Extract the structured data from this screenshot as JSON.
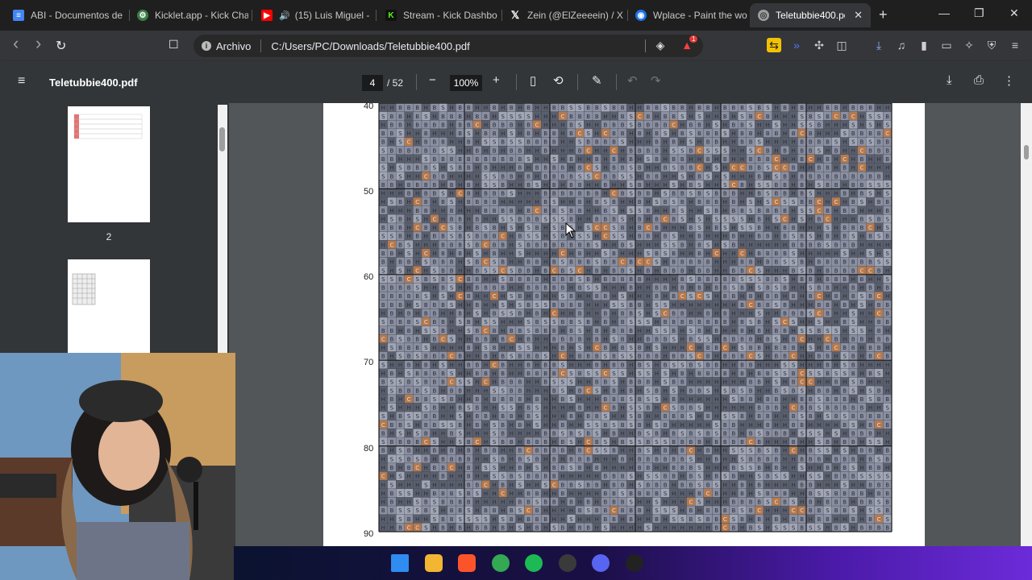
{
  "tabs": [
    {
      "title": "ABI - Documentos de",
      "favicon": "docs-icon",
      "color": "#4285f4"
    },
    {
      "title": "Kicklet.app - Kick Cha",
      "favicon": "kicklet-icon",
      "color": "#3a7d44"
    },
    {
      "title": "(15) Luis Miguel -",
      "favicon": "youtube-icon",
      "color": "#ff0000",
      "audio": "🔊"
    },
    {
      "title": "Stream - Kick Dashbo",
      "favicon": "kick-icon",
      "color": "#53fc18"
    },
    {
      "title": "Zein (@ElZeeeein) / X",
      "favicon": "x-icon",
      "color": "#000000"
    },
    {
      "title": "Wplace - Paint the wo",
      "favicon": "globe-icon",
      "color": "#1a73e8"
    },
    {
      "title": "Teletubbie400.pd",
      "favicon": "pdf-icon",
      "color": "#9e9e9e",
      "active": true
    }
  ],
  "tab_close": "✕",
  "new_tab": "+",
  "window_controls": {
    "minimize": "—",
    "maximize": "❐",
    "close": "✕"
  },
  "address": {
    "scheme_label": "Archivo",
    "url": "C:/Users/PC/Downloads/Teletubbie400.pdf",
    "info_icon": "i"
  },
  "nav": {
    "back": "‹",
    "forward": "›",
    "reload": "↻",
    "bookmark": "☐"
  },
  "extensions": [
    {
      "name": "brave-shield-icon",
      "glyph": "🛡"
    },
    {
      "name": "brave-rewards-icon",
      "glyph": "▲",
      "badge": "1"
    },
    {
      "name": "extension-yellow-icon",
      "glyph": "⇆"
    },
    {
      "name": "extension-blue-icon",
      "glyph": "»"
    },
    {
      "name": "extensions-puzzle-icon",
      "glyph": "⚙"
    },
    {
      "name": "screenshot-icon",
      "glyph": "◫"
    },
    {
      "name": "downloads-icon",
      "glyph": "⤓"
    },
    {
      "name": "media-icon",
      "glyph": "♫"
    },
    {
      "name": "sidebar-icon",
      "glyph": "▯"
    },
    {
      "name": "wallet-icon",
      "glyph": "▭"
    },
    {
      "name": "leo-icon",
      "glyph": "✧"
    },
    {
      "name": "vpn-icon",
      "glyph": "⛨"
    },
    {
      "name": "menu-icon",
      "glyph": "≡"
    }
  ],
  "pdf": {
    "menu_glyph": "≡",
    "title": "Teletubbie400.pdf",
    "page_current": "4",
    "page_total": "/ 52",
    "zoom": "100%",
    "zoom_out": "−",
    "zoom_in": "+",
    "fit_glyph": "▯",
    "rotate_glyph": "⟲",
    "annotate_glyph": "✎",
    "undo_glyph": "↶",
    "redo_glyph": "↷",
    "download_glyph": "⤓",
    "print_glyph": "⎙",
    "more_glyph": "⋮"
  },
  "thumbnails": [
    {
      "label": "2"
    },
    {
      "label": ""
    }
  ],
  "grid": {
    "row_labels": [
      "40",
      "50",
      "60",
      "70",
      "80",
      "90"
    ],
    "symbols": [
      "B",
      "H",
      "S",
      "C"
    ],
    "colors": {
      "B": "#8a8fa2",
      "H": "#5a5f6e",
      "S": "#a1a6b6",
      "C": "#b37a52"
    }
  },
  "taskbar_icons": [
    {
      "name": "windows-start-icon",
      "color": "#2f8cf0"
    },
    {
      "name": "file-explorer-icon",
      "color": "#f2b632"
    },
    {
      "name": "brave-browser-icon",
      "color": "#fb542b"
    },
    {
      "name": "chrome-icon",
      "color": "#34a853"
    },
    {
      "name": "spotify-icon",
      "color": "#1db954"
    },
    {
      "name": "obs-icon",
      "color": "#3a3a3a"
    },
    {
      "name": "discord-icon",
      "color": "#5865f2"
    },
    {
      "name": "app-icon",
      "color": "#222222"
    }
  ]
}
